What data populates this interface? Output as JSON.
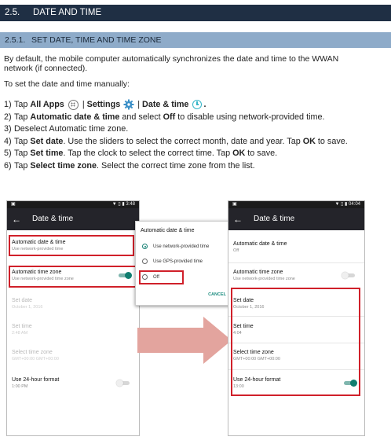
{
  "section": {
    "number": "2.5.",
    "title": "DATE AND TIME"
  },
  "subsection": {
    "number": "2.5.1.",
    "title": "SET DATE, TIME AND TIME ZONE"
  },
  "intro": {
    "line1": "By default, the mobile computer automatically synchronizes the date and time to the WWAN",
    "line2": "network (if connected).",
    "line3": "To set the date and time manually:"
  },
  "steps": [
    {
      "num": "1)",
      "a": "Tap ",
      "b": "All Apps",
      "c": " | ",
      "d": "Settings",
      "e": " | ",
      "f": "Date & time",
      "g": "."
    },
    {
      "num": "2)",
      "a": "Tap ",
      "b": "Automatic date & time",
      "c": " and select ",
      "d": "Off",
      "e": " to disable using network-provided time."
    },
    {
      "num": "3)",
      "text": "Deselect Automatic time zone."
    },
    {
      "num": "4)",
      "a": "Tap ",
      "b": "Set date",
      "c": ". Use the sliders to select the correct month, date and year. Tap ",
      "d": "OK",
      "e": " to save."
    },
    {
      "num": "5)",
      "a": "Tap ",
      "b": "Set time",
      "c": ". Tap the clock to select the correct time. Tap ",
      "d": "OK",
      "e": " to save."
    },
    {
      "num": "6)",
      "a": "Tap ",
      "b": "Select time zone",
      "c": ". Select the correct time zone from the list."
    }
  ],
  "phone_left": {
    "time": "3:48",
    "title": "Date & time",
    "items": [
      {
        "title": "Automatic date & time",
        "sub": "Use network-provided time"
      },
      {
        "title": "Automatic time zone",
        "sub": "Use network-provided time zone"
      },
      {
        "title": "Set date",
        "sub": "October 1, 2016"
      },
      {
        "title": "Set time",
        "sub": "2:48 AM"
      },
      {
        "title": "Select time zone",
        "sub": "GMT+00:00 GMT+00:00"
      },
      {
        "title": "Use 24-hour format",
        "sub": "1:00 PM"
      }
    ]
  },
  "dialog": {
    "title": "Automatic date & time",
    "options": [
      "Use network-provided time",
      "Use GPS-provided time",
      "Off"
    ],
    "cancel": "CANCEL"
  },
  "phone_right": {
    "time": "04:04",
    "title": "Date & time",
    "items": [
      {
        "title": "Automatic date & time",
        "sub": "Off"
      },
      {
        "title": "Automatic time zone",
        "sub": "Use network-provided time zone"
      },
      {
        "title": "Set date",
        "sub": "October 1, 2016"
      },
      {
        "title": "Set time",
        "sub": "4:04"
      },
      {
        "title": "Select time zone",
        "sub": "GMT+00:00 GMT+00:00"
      },
      {
        "title": "Use 24-hour format",
        "sub": "13:00"
      }
    ]
  },
  "colors": {
    "heading_bar": "#1f2f44",
    "subheading_bar": "#8eabc9",
    "highlight_box": "#d0202a",
    "accent_teal": "#117e70"
  },
  "icons": [
    "apps-icon",
    "settings-gear-icon",
    "clock-icon",
    "right-arrow-icon"
  ]
}
